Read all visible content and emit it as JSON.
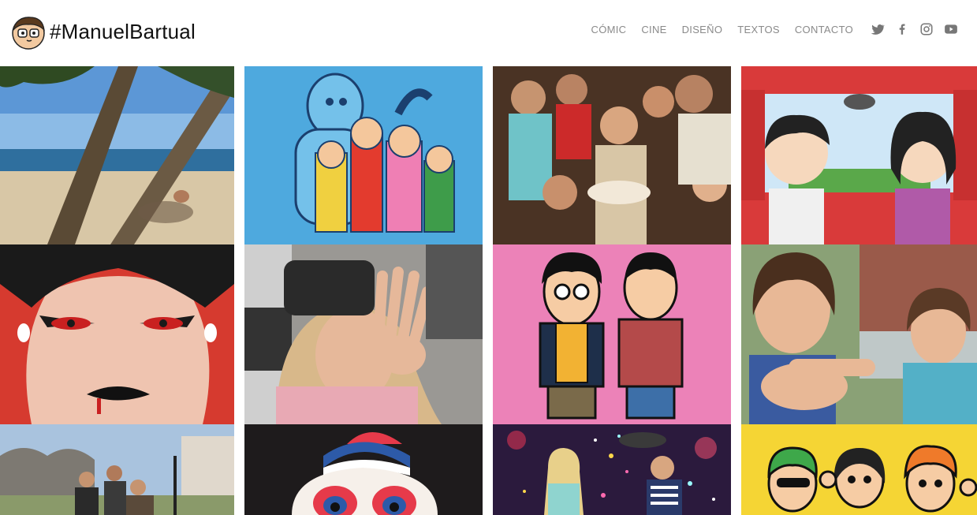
{
  "site": {
    "title": "#ManuelBartual",
    "accent": "#111111",
    "nav_color": "#8a8a8a"
  },
  "nav": {
    "items": [
      {
        "label": "CÓMIC"
      },
      {
        "label": "CINE"
      },
      {
        "label": "DISEÑO"
      },
      {
        "label": "TEXTOS"
      },
      {
        "label": "CONTACTO"
      }
    ],
    "social": [
      "twitter-icon",
      "facebook-icon",
      "instagram-icon",
      "youtube-icon"
    ]
  },
  "gallery": {
    "tiles": [
      {
        "name": "beach-trees-photo",
        "bg": "#6fa6d8"
      },
      {
        "name": "comic-characters-blue-illustration",
        "bg": "#4ea9de"
      },
      {
        "name": "birthday-party-photo",
        "bg": "#5a3b2a"
      },
      {
        "name": "car-emoji-illustration",
        "bg": "#d93a3a"
      },
      {
        "name": "vampire-woman-illustration",
        "bg": "#d63a2f"
      },
      {
        "name": "vr-headset-woman-photo",
        "bg": "#8c8a88"
      },
      {
        "name": "two-men-pink-illustration",
        "bg": "#ec82b8"
      },
      {
        "name": "children-pointing-photo",
        "bg": "#6e8a5c"
      },
      {
        "name": "park-people-photo",
        "bg": "#9db8d6"
      },
      {
        "name": "clown-face-illustration",
        "bg": "#1e1b1c"
      },
      {
        "name": "confetti-party-photo",
        "bg": "#2b1a3d"
      },
      {
        "name": "comic-faces-yellow-illustration",
        "bg": "#f5d534"
      }
    ]
  }
}
